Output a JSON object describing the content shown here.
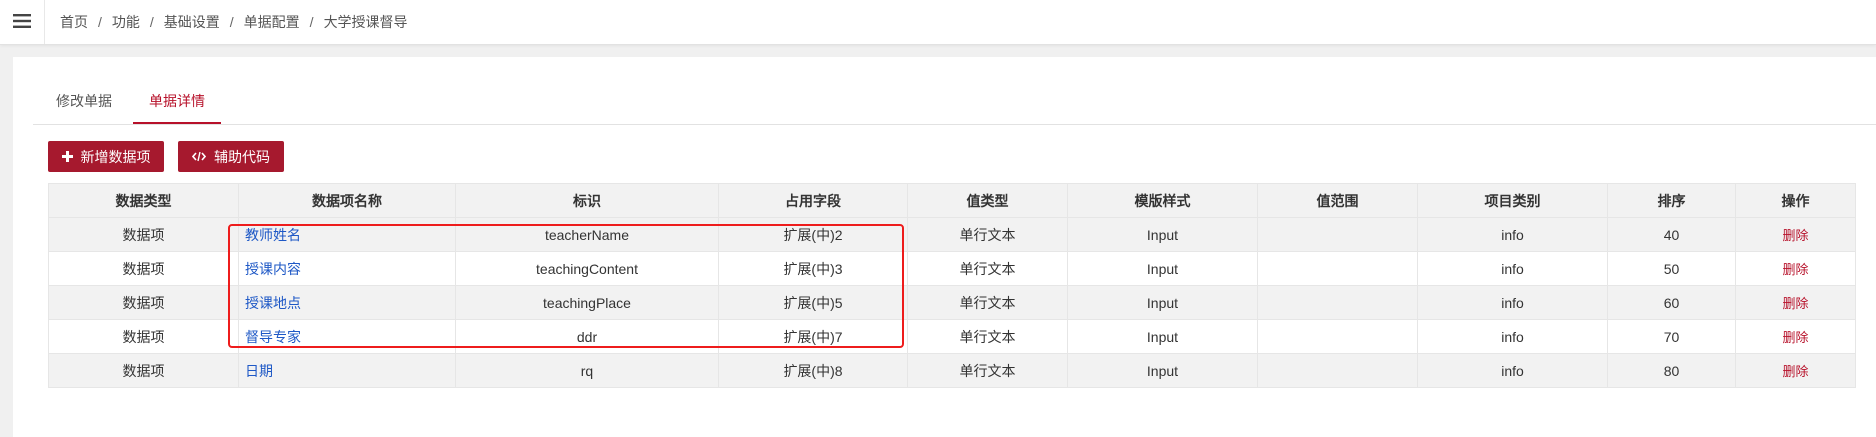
{
  "breadcrumb": [
    "首页",
    "功能",
    "基础设置",
    "单据配置",
    "大学授课督导"
  ],
  "tabs": [
    "修改单据",
    "单据详情"
  ],
  "buttons": {
    "add": "新增数据项",
    "code": "辅助代码"
  },
  "table": {
    "headers": [
      "数据类型",
      "数据项名称",
      "标识",
      "占用字段",
      "值类型",
      "模版样式",
      "值范围",
      "项目类别",
      "排序",
      "操作"
    ],
    "rows": [
      [
        "数据项",
        "教师姓名",
        "teacherName",
        "扩展(中)2",
        "单行文本",
        "Input",
        "",
        "info",
        "40",
        "删除"
      ],
      [
        "数据项",
        "授课内容",
        "teachingContent",
        "扩展(中)3",
        "单行文本",
        "Input",
        "",
        "info",
        "50",
        "删除"
      ],
      [
        "数据项",
        "授课地点",
        "teachingPlace",
        "扩展(中)5",
        "单行文本",
        "Input",
        "",
        "info",
        "60",
        "删除"
      ],
      [
        "数据项",
        "督导专家",
        "ddr",
        "扩展(中)7",
        "单行文本",
        "Input",
        "",
        "info",
        "70",
        "删除"
      ],
      [
        "数据项",
        "日期",
        "rq",
        "扩展(中)8",
        "单行文本",
        "Input",
        "",
        "info",
        "80",
        "删除"
      ]
    ]
  },
  "colors": {
    "brand": "#a6192e",
    "active_tab": "#b7112a",
    "link": "#1e58c6",
    "highlight": "#ee1c1c"
  },
  "icons": {
    "menu": "hamburger-icon",
    "add": "plus-icon",
    "code": "code-icon"
  }
}
